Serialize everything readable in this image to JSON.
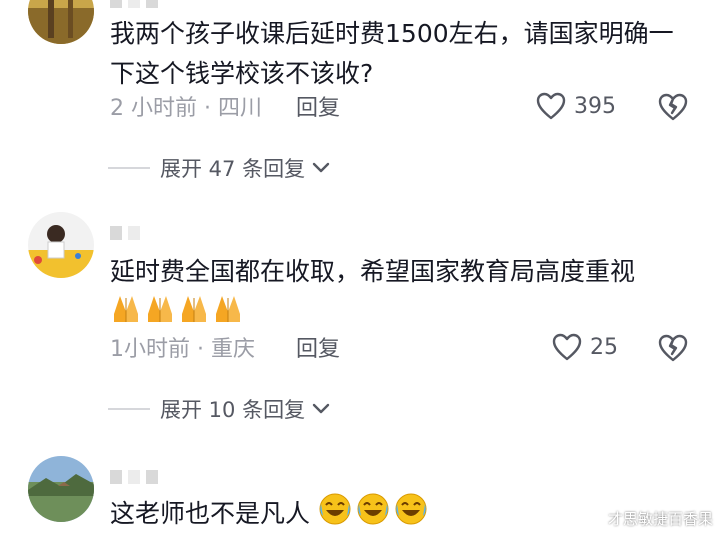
{
  "comments": [
    {
      "text": "我两个孩子收课后延时费1500左右，请国家明确一下这个钱学校该不该收?",
      "time_location": "2 小时前 · 四川",
      "reply_label": "回复",
      "likes": "395",
      "replies_label": "展开 47 条回复"
    },
    {
      "text": "延时费全国都在收取，希望国家教育局高度重视",
      "time_location": "1小时前 · 重庆",
      "reply_label": "回复",
      "likes": "25",
      "replies_label": "展开 10 条回复"
    },
    {
      "text": "这老师也不是凡人"
    }
  ],
  "watermark": "才思敏捷百香果",
  "colors": {
    "text": "#161823",
    "secondary": "#9b9da6",
    "action": "#555862",
    "emoji_pray": "#f5a623",
    "emoji_laugh": "#f7c21a"
  },
  "icons": [
    "heart-icon",
    "broken-heart-icon",
    "chevron-down-icon",
    "folded-hands-emoji",
    "laughing-tears-emoji"
  ]
}
